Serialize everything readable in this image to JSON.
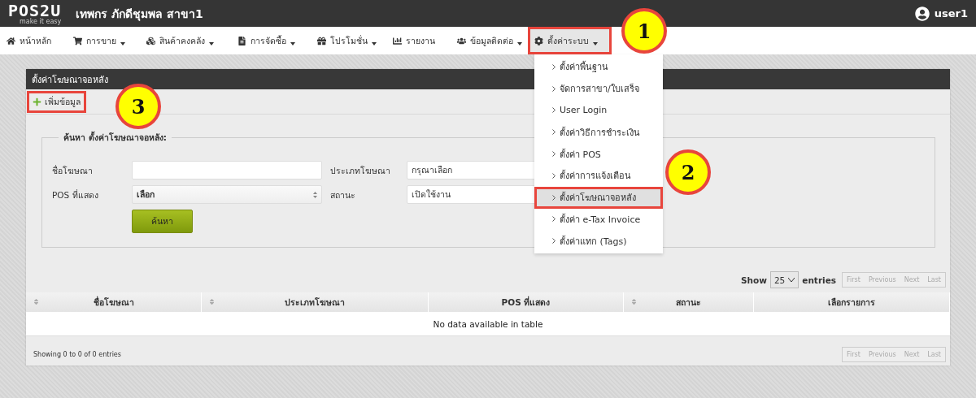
{
  "header": {
    "logo": "POS2U",
    "logo_tagline": "make it easy",
    "store_name": "เทพกร ภักดีชุมพล สาขา1",
    "user": "user1"
  },
  "nav": [
    {
      "label": "หน้าหลัก",
      "dropdown": false,
      "selected": false,
      "highlighted": false
    },
    {
      "label": "การขาย",
      "dropdown": true,
      "selected": false,
      "highlighted": false
    },
    {
      "label": "สินค้าคงคลัง",
      "dropdown": true,
      "selected": false,
      "highlighted": false
    },
    {
      "label": "การจัดซื้อ",
      "dropdown": true,
      "selected": false,
      "highlighted": false
    },
    {
      "label": "โปรโมชั่น",
      "dropdown": true,
      "selected": false,
      "highlighted": false
    },
    {
      "label": "รายงาน",
      "dropdown": false,
      "selected": false,
      "highlighted": false
    },
    {
      "label": "ข้อมูลติดต่อ",
      "dropdown": true,
      "selected": false,
      "highlighted": false
    },
    {
      "label": "ตั้งค่าระบบ",
      "dropdown": true,
      "selected": true,
      "highlighted": true
    }
  ],
  "dropdown_menu": [
    {
      "label": "ตั้งค่าพื้นฐาน",
      "selected": false,
      "highlighted": false
    },
    {
      "label": "จัดการสาขา/ใบเสร็จ",
      "selected": false,
      "highlighted": false
    },
    {
      "label": "User Login",
      "selected": false,
      "highlighted": false
    },
    {
      "label": "ตั้งค่าวิธีการชำระเงิน",
      "selected": false,
      "highlighted": false
    },
    {
      "label": "ตั้งค่า POS",
      "selected": false,
      "highlighted": false
    },
    {
      "label": "ตั้งค่าการแจ้งเตือน",
      "selected": false,
      "highlighted": false
    },
    {
      "label": "ตั้งค่าโฆษณาจอหลัง",
      "selected": true,
      "highlighted": true
    },
    {
      "label": "ตั้งค่า e-Tax Invoice",
      "selected": false,
      "highlighted": false
    },
    {
      "label": "ตั้งค่าแทก (Tags)",
      "selected": false,
      "highlighted": false
    }
  ],
  "panel": {
    "title": "ตั้งค่าโฆษณาจอหลัง",
    "add_button": {
      "label": "เพิ่มข้อมูล",
      "highlighted": true
    },
    "search": {
      "legend": "ค้นหา ตั้งค่าโฆษณาจอหลัง:",
      "fields": [
        {
          "label": "ชื่อโฆษณา",
          "kind": "text"
        },
        {
          "label": "ประเภทโฆษณา",
          "kind": "select",
          "value": "กรุณาเลือก"
        },
        {
          "label": "POS ที่แสดง",
          "kind": "native-select",
          "value": "เลือก"
        },
        {
          "label": "สถานะ",
          "kind": "select",
          "value": "เปิดใช้งาน"
        }
      ],
      "button": "ค้นหา"
    },
    "table": {
      "show_label": "Show",
      "page_size": "25",
      "entries_label": "entries",
      "columns": [
        {
          "label": "ชื่อโฆษณา",
          "sortable": true
        },
        {
          "label": "ประเภทโฆษณา",
          "sortable": true
        },
        {
          "label": "POS ที่แสดง",
          "sortable": false
        },
        {
          "label": "สถานะ",
          "sortable": true
        },
        {
          "label": "เลือกรายการ",
          "sortable": false
        }
      ],
      "empty_message": "No data available in table",
      "info": "Showing 0 to 0 of 0 entries",
      "pager_top": [
        {
          "label": "First",
          "disabled": true
        },
        {
          "label": "Previous",
          "disabled": true
        },
        {
          "label": "Next",
          "disabled": true
        },
        {
          "label": "Last",
          "disabled": true
        }
      ],
      "pager_bottom": [
        {
          "label": "First",
          "disabled": true
        },
        {
          "label": "Previous",
          "disabled": true
        },
        {
          "label": "Next",
          "disabled": true
        },
        {
          "label": "Last",
          "disabled": true
        }
      ]
    }
  },
  "annotations": [
    {
      "number": "1"
    },
    {
      "number": "2"
    },
    {
      "number": "3"
    }
  ]
}
